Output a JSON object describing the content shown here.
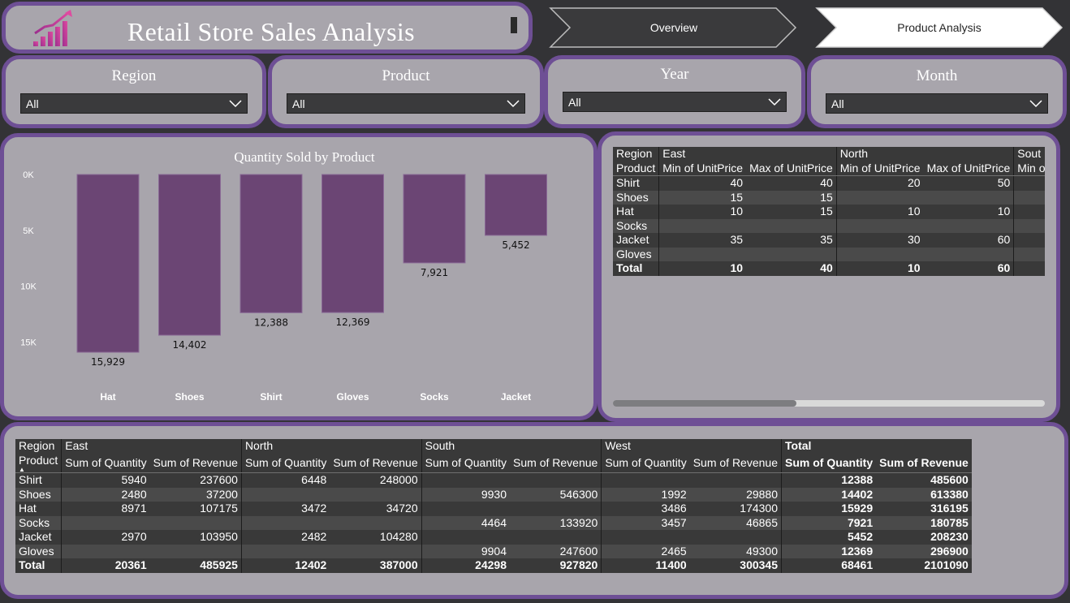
{
  "header": {
    "title": "Retail Store Sales Analysis",
    "logo_icon": "bar-chart-growth-icon"
  },
  "nav": {
    "overview_label": "Overview",
    "product_analysis_label": "Product Analysis"
  },
  "slicers": {
    "region": {
      "title": "Region",
      "value": "All"
    },
    "product": {
      "title": "Product",
      "value": "All"
    },
    "year": {
      "title": "Year",
      "value": "All"
    },
    "month": {
      "title": "Month",
      "value": "All"
    }
  },
  "chart_data": {
    "type": "bar",
    "title": "Quantity Sold by Product",
    "categories": [
      "Hat",
      "Shoes",
      "Shirt",
      "Gloves",
      "Socks",
      "Jacket"
    ],
    "values": [
      15929,
      14402,
      12388,
      12369,
      7921,
      5452
    ],
    "value_labels": [
      "15,929",
      "14,402",
      "12,388",
      "12,369",
      "7,921",
      "5,452"
    ],
    "y_ticks": [
      "0K",
      "5K",
      "10K",
      "15K"
    ],
    "y_reversed": true,
    "ylim": [
      0,
      16000
    ],
    "bar_color": "#6b4574"
  },
  "matrix_top": {
    "row_header_1": "Region",
    "row_header_2": "Product",
    "regions": [
      "East",
      "North",
      "Sout"
    ],
    "measures": [
      "Min of UnitPrice",
      "Max of UnitPrice",
      "Min of UnitPrice",
      "Max of UnitPrice",
      "Min o"
    ],
    "rows": [
      {
        "product": "Shirt",
        "values": [
          "40",
          "40",
          "20",
          "50",
          ""
        ]
      },
      {
        "product": "Shoes",
        "values": [
          "15",
          "15",
          "",
          "",
          ""
        ]
      },
      {
        "product": "Hat",
        "values": [
          "10",
          "15",
          "10",
          "10",
          ""
        ]
      },
      {
        "product": "Socks",
        "values": [
          "",
          "",
          "",
          "",
          ""
        ]
      },
      {
        "product": "Jacket",
        "values": [
          "35",
          "35",
          "30",
          "60",
          ""
        ]
      },
      {
        "product": "Gloves",
        "values": [
          "",
          "",
          "",
          "",
          ""
        ]
      }
    ],
    "total": {
      "label": "Total",
      "values": [
        "10",
        "40",
        "10",
        "60",
        ""
      ]
    }
  },
  "matrix_bottom": {
    "row_header_1": "Region",
    "row_header_2": "Product",
    "regions": [
      "East",
      "North",
      "South",
      "West",
      "Total"
    ],
    "measures": [
      "Sum of Quantity",
      "Sum of Revenue",
      "Sum of Quantity",
      "Sum of Revenue",
      "Sum of Quantity",
      "Sum of Revenue",
      "Sum of Quantity",
      "Sum of Revenue",
      "Sum of Quantity",
      "Sum of Revenue"
    ],
    "rows": [
      {
        "product": "Shirt",
        "values": [
          "5940",
          "237600",
          "6448",
          "248000",
          "",
          "",
          "",
          "",
          "12388",
          "485600"
        ]
      },
      {
        "product": "Shoes",
        "values": [
          "2480",
          "37200",
          "",
          "",
          "9930",
          "546300",
          "1992",
          "29880",
          "14402",
          "613380"
        ]
      },
      {
        "product": "Hat",
        "values": [
          "8971",
          "107175",
          "3472",
          "34720",
          "",
          "",
          "3486",
          "174300",
          "15929",
          "316195"
        ]
      },
      {
        "product": "Socks",
        "values": [
          "",
          "",
          "",
          "",
          "4464",
          "133920",
          "3457",
          "46865",
          "7921",
          "180785"
        ]
      },
      {
        "product": "Jacket",
        "values": [
          "2970",
          "103950",
          "2482",
          "104280",
          "",
          "",
          "",
          "",
          "5452",
          "208230"
        ]
      },
      {
        "product": "Gloves",
        "values": [
          "",
          "",
          "",
          "",
          "9904",
          "247600",
          "2465",
          "49300",
          "12369",
          "296900"
        ]
      }
    ],
    "total": {
      "label": "Total",
      "values": [
        "20361",
        "485925",
        "12402",
        "387000",
        "24298",
        "927820",
        "11400",
        "300345",
        "68461",
        "2101090"
      ]
    }
  }
}
